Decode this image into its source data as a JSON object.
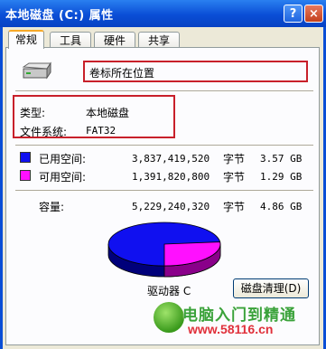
{
  "window": {
    "title": "本地磁盘 (C:) 属性",
    "help_label": "?",
    "close_label": "×"
  },
  "tabs": [
    "常规",
    "工具",
    "硬件",
    "共享"
  ],
  "volume_label_value": "卷标所在位置",
  "info": {
    "type_label": "类型:",
    "type_value": "本地磁盘",
    "fs_label": "文件系统:",
    "fs_value": "FAT32"
  },
  "space": {
    "used": {
      "label": "已用空间:",
      "bytes": "3,837,419,520",
      "unit": "字节",
      "size": "3.57 GB",
      "color": "#1010f0"
    },
    "free": {
      "label": "可用空间:",
      "bytes": "1,391,820,800",
      "unit": "字节",
      "size": "1.29 GB",
      "color": "#ff10ff"
    },
    "capacity": {
      "label": "容量:",
      "bytes": "5,229,240,320",
      "unit": "字节",
      "size": "4.86 GB"
    }
  },
  "pie": {
    "used_fraction": 0.7338,
    "used_color": "#1010f0",
    "free_color": "#ff10ff"
  },
  "drive_label": "驱动器 C",
  "cleanup_button": "磁盘清理(D)",
  "watermark": {
    "title": "电脑入门到精通",
    "url": "www.58116.cn"
  }
}
